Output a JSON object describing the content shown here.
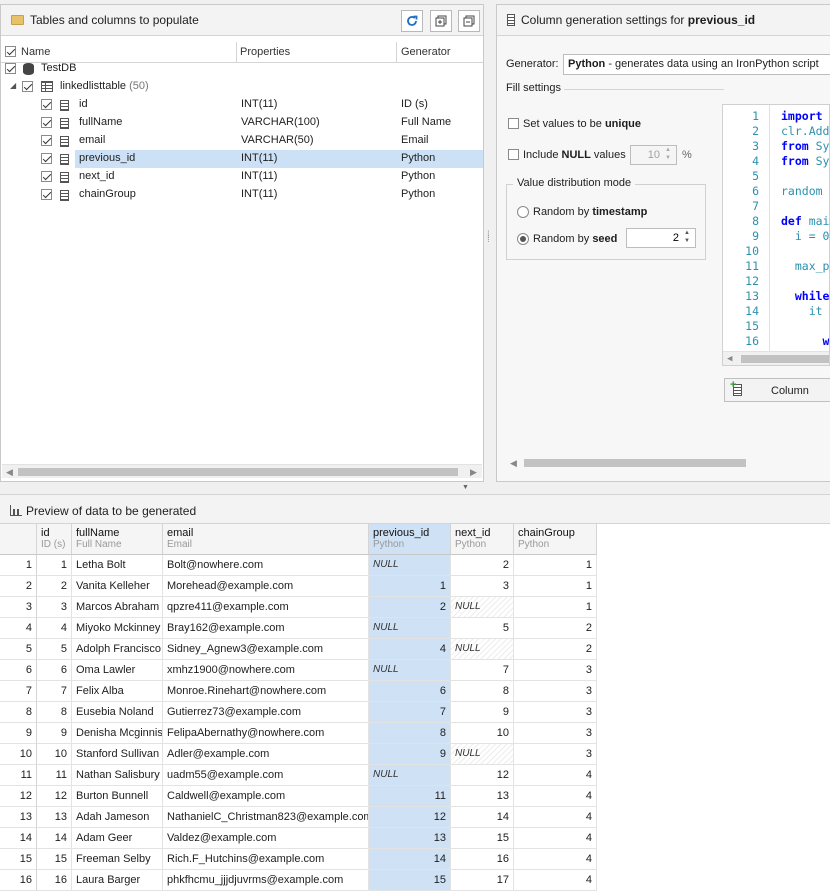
{
  "left_panel": {
    "title": "Tables and columns to populate",
    "columns": [
      "Name",
      "Properties",
      "Generator"
    ],
    "db": "TestDB",
    "table": "linkedlisttable",
    "table_count": "(50)",
    "rows": [
      {
        "name": "id",
        "props": "INT(11)",
        "gen": "ID (s)"
      },
      {
        "name": "fullName",
        "props": "VARCHAR(100)",
        "gen": "Full Name"
      },
      {
        "name": "email",
        "props": "VARCHAR(50)",
        "gen": "Email"
      },
      {
        "name": "previous_id",
        "props": "INT(11)",
        "gen": "Python"
      },
      {
        "name": "next_id",
        "props": "INT(11)",
        "gen": "Python"
      },
      {
        "name": "chainGroup",
        "props": "INT(11)",
        "gen": "Python"
      }
    ]
  },
  "right_panel": {
    "title_prefix": "Column generation settings for ",
    "title_col": "previous_id",
    "generator_label": "Generator:",
    "generator_name": "Python",
    "generator_desc": " - generates data using an IronPython script",
    "fill_settings": "Fill settings",
    "unique_prefix": "Set values to be ",
    "unique_bold": "unique",
    "null_prefix": "Include ",
    "null_bold": "NULL",
    "null_suffix": " values",
    "null_value": "10",
    "percent": "%",
    "dist_title": "Value distribution mode",
    "rand_ts_prefix": "Random by ",
    "rand_ts_bold": "timestamp",
    "rand_seed_prefix": "Random by ",
    "rand_seed_bold": "seed",
    "seed_value": "2",
    "column_button": "Column",
    "code_lines": [
      {
        "n": "1",
        "parts": [
          {
            "t": "import",
            "c": "kw"
          }
        ]
      },
      {
        "n": "2",
        "parts": [
          {
            "t": "clr.Add",
            "c": "teal"
          }
        ]
      },
      {
        "n": "3",
        "parts": [
          {
            "t": "from",
            "c": "kw"
          },
          {
            "t": " Sy",
            "c": "teal"
          }
        ]
      },
      {
        "n": "4",
        "parts": [
          {
            "t": "from",
            "c": "kw"
          },
          {
            "t": " Sy",
            "c": "teal"
          }
        ]
      },
      {
        "n": "5",
        "parts": []
      },
      {
        "n": "6",
        "parts": [
          {
            "t": "random",
            "c": "teal"
          }
        ]
      },
      {
        "n": "7",
        "parts": []
      },
      {
        "n": "8",
        "parts": [
          {
            "t": "def",
            "c": "kw"
          },
          {
            "t": " mai",
            "c": "teal"
          }
        ]
      },
      {
        "n": "9",
        "parts": [
          {
            "t": "  i = 0",
            "c": "teal"
          }
        ]
      },
      {
        "n": "10",
        "parts": []
      },
      {
        "n": "11",
        "parts": [
          {
            "t": "  max_p",
            "c": "teal"
          }
        ]
      },
      {
        "n": "12",
        "parts": []
      },
      {
        "n": "13",
        "parts": [
          {
            "t": "  while",
            "c": "kw"
          }
        ]
      },
      {
        "n": "14",
        "parts": [
          {
            "t": "    it",
            "c": "teal"
          }
        ]
      },
      {
        "n": "15",
        "parts": []
      },
      {
        "n": "16",
        "parts": [
          {
            "t": "      wh",
            "c": "kw"
          }
        ]
      }
    ]
  },
  "preview": {
    "title": "Preview of data to be generated",
    "headers": [
      {
        "name": "id",
        "sub": "ID (s)"
      },
      {
        "name": "fullName",
        "sub": "Full Name"
      },
      {
        "name": "email",
        "sub": "Email"
      },
      {
        "name": "previous_id",
        "sub": "Python"
      },
      {
        "name": "next_id",
        "sub": "Python"
      },
      {
        "name": "chainGroup",
        "sub": "Python"
      }
    ],
    "rows": [
      [
        "1",
        "1",
        "Letha Bolt",
        "Bolt@nowhere.com",
        "NULL",
        "2",
        "1"
      ],
      [
        "2",
        "2",
        "Vanita Kelleher",
        "Morehead@example.com",
        "1",
        "3",
        "1"
      ],
      [
        "3",
        "3",
        "Marcos Abraham",
        "qpzre411@example.com",
        "2",
        "NULL",
        "1"
      ],
      [
        "4",
        "4",
        "Miyoko Mckinney",
        "Bray162@example.com",
        "NULL",
        "5",
        "2"
      ],
      [
        "5",
        "5",
        "Adolph Francisco",
        "Sidney_Agnew3@example.com",
        "4",
        "NULL",
        "2"
      ],
      [
        "6",
        "6",
        "Oma Lawler",
        "xmhz1900@nowhere.com",
        "NULL",
        "7",
        "3"
      ],
      [
        "7",
        "7",
        "Felix Alba",
        "Monroe.Rinehart@nowhere.com",
        "6",
        "8",
        "3"
      ],
      [
        "8",
        "8",
        "Eusebia Noland",
        "Gutierrez73@example.com",
        "7",
        "9",
        "3"
      ],
      [
        "9",
        "9",
        "Denisha Mcginnis",
        "FelipaAbernathy@nowhere.com",
        "8",
        "10",
        "3"
      ],
      [
        "10",
        "10",
        "Stanford Sullivan",
        "Adler@example.com",
        "9",
        "NULL",
        "3"
      ],
      [
        "11",
        "11",
        "Nathan Salisbury",
        "uadm55@example.com",
        "NULL",
        "12",
        "4"
      ],
      [
        "12",
        "12",
        "Burton Bunnell",
        "Caldwell@example.com",
        "11",
        "13",
        "4"
      ],
      [
        "13",
        "13",
        "Adah Jameson",
        "NathanielC_Christman823@example.com",
        "12",
        "14",
        "4"
      ],
      [
        "14",
        "14",
        "Adam Geer",
        "Valdez@example.com",
        "13",
        "15",
        "4"
      ],
      [
        "15",
        "15",
        "Freeman Selby",
        "Rich.F_Hutchins@example.com",
        "14",
        "16",
        "4"
      ],
      [
        "16",
        "16",
        "Laura Barger",
        "phkfhcmu_jjjdjuvrms@example.com",
        "15",
        "17",
        "4"
      ]
    ]
  }
}
